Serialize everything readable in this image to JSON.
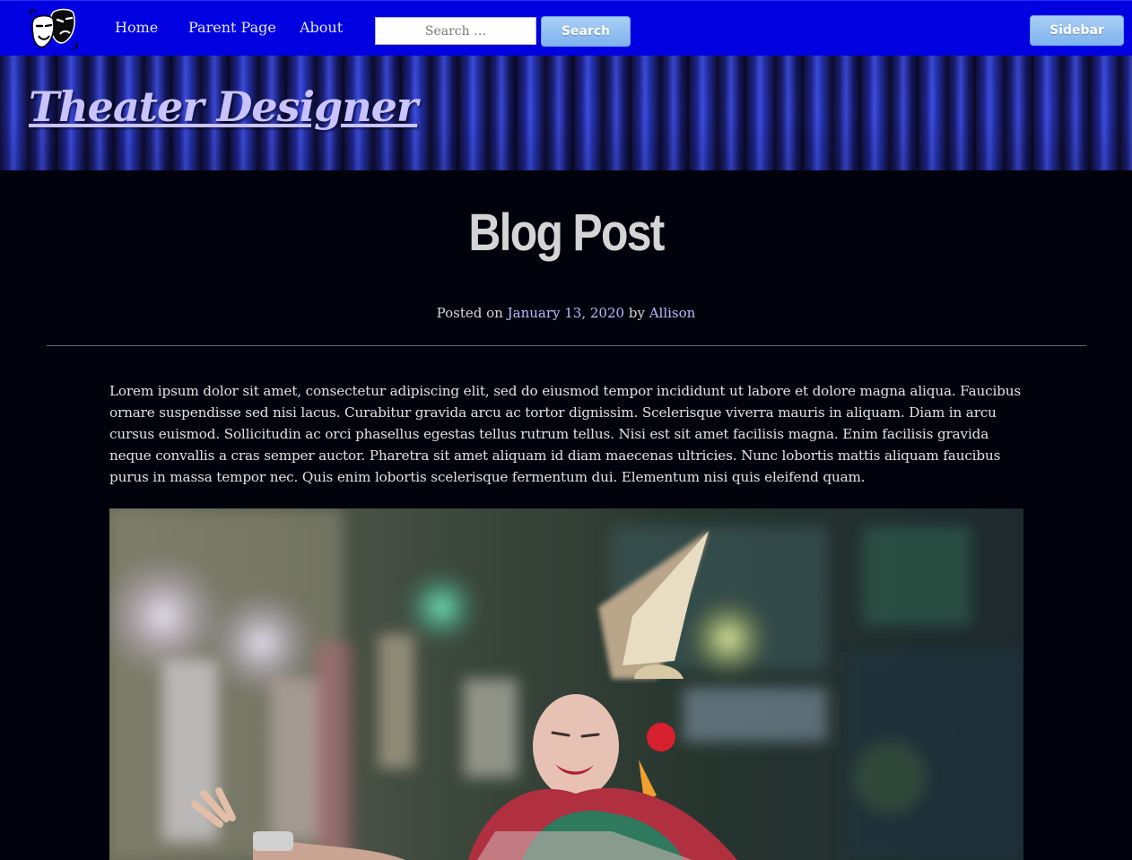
{
  "nav": {
    "logo_alt": "theater masks logo",
    "links": [
      "Home",
      "Parent Page",
      "About"
    ],
    "search": {
      "placeholder": "Search …",
      "value": ""
    },
    "search_button": "Search",
    "sidebar_button": "Sidebar"
  },
  "header": {
    "site_title": "Theater Designer"
  },
  "post": {
    "title": "Blog Post",
    "meta": {
      "posted_on_prefix": "Posted on",
      "date": "January 13, 2020",
      "by_prefix": "by",
      "author": "Allison"
    },
    "body": "Lorem ipsum dolor sit amet, consectetur adipiscing elit, sed do eiusmod tempor incididunt ut labore et dolore magna aliqua. Faucibus ornare suspendisse sed nisi lacus. Curabitur gravida arcu ac tortor dignissim. Scelerisque viverra mauris in aliquam. Diam in arcu cursus euismod. Sollicitudin ac orci phasellus egestas tellus rutrum tellus. Nisi est sit amet facilisis magna. Enim facilisis gravida neque convallis a cras semper auctor. Pharetra sit amet aliquam id diam maecenas ultricies. Nunc lobortis mattis aliquam faucibus purus in massa tempor nec. Quis enim lobortis scelerisque fermentum dui. Elementum nisi quis eleifend quam.",
    "image_alt": "Thai dancer in ornate headdress and costume"
  },
  "colors": {
    "nav_background": "#0000e0",
    "page_background": "#02020c",
    "link": "#b7bcff",
    "button": "#8fbdf2"
  }
}
